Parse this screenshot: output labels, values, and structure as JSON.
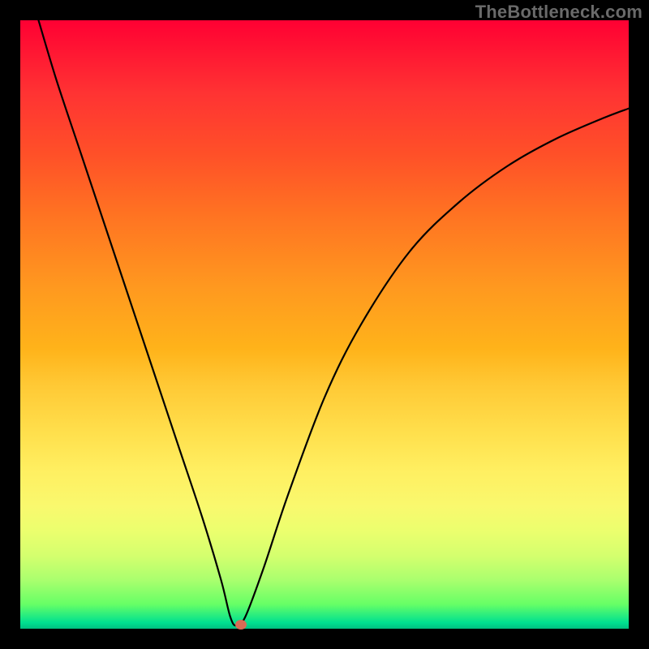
{
  "watermark": "TheBottleneck.com",
  "chart_data": {
    "type": "line",
    "title": "",
    "xlabel": "",
    "ylabel": "",
    "x_range": [
      0,
      100
    ],
    "y_range": [
      0,
      100
    ],
    "curve": {
      "name": "bottleneck-curve",
      "x": [
        3,
        6,
        10,
        14,
        18,
        22,
        26,
        30,
        33,
        34.5,
        35.5,
        37,
        40,
        44,
        50,
        56,
        64,
        72,
        80,
        88,
        96,
        100
      ],
      "y": [
        100,
        90,
        78,
        66,
        54,
        42,
        30,
        18,
        8,
        2,
        0.5,
        2,
        10,
        22,
        38,
        50,
        62,
        70,
        76,
        80.5,
        84,
        85.5
      ]
    },
    "marker": {
      "x": 36.3,
      "y": 0.7,
      "color": "#d96b55"
    },
    "background_gradient": {
      "top": "#ff0033",
      "mid": "#ffcc33",
      "bottom": "#00c080"
    }
  }
}
